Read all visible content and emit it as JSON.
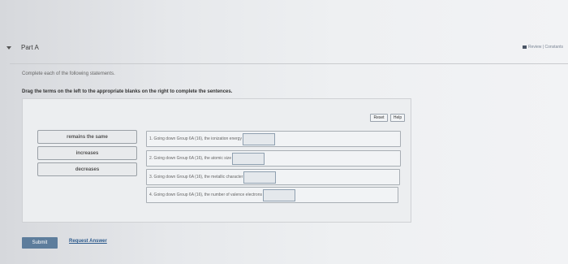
{
  "header": {
    "part_title": "Part A",
    "top_right_text": "Review | Constants"
  },
  "instructions": {
    "line1": "Complete each of the following statements.",
    "line2": "Drag the terms on the left to the appropriate blanks on the right to complete the sentences."
  },
  "toolbar": {
    "reset_label": "Reset",
    "help_label": "Help"
  },
  "terms": [
    "remains the same",
    "increases",
    "decreases"
  ],
  "sentences": [
    "1. Going down Group 6A (16), the ionization energy",
    "2. Going down Group 6A (16), the atomic size",
    "3. Going down Group 6A (16), the metallic character",
    "4. Going down Group 6A (16), the number of valence electrons"
  ],
  "actions": {
    "submit_label": "Submit",
    "request_answer_label": "Request Answer"
  },
  "colors": {
    "submit_bg": "#5d7d9c",
    "link": "#2c5a8c"
  }
}
